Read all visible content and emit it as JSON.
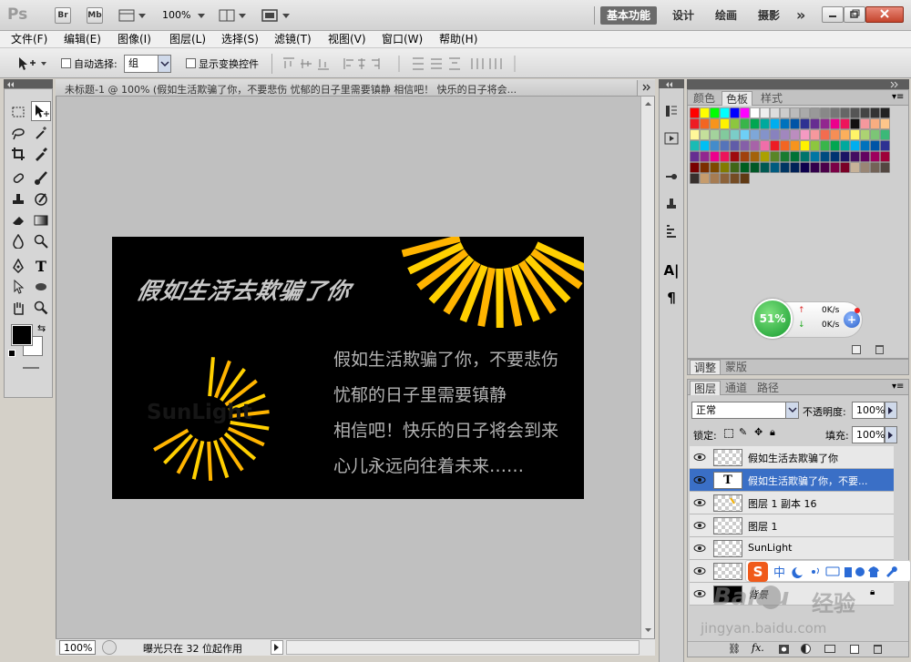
{
  "titlebar": {
    "ps_logo": "Ps",
    "br": "Br",
    "mb": "Mb",
    "zoom": "100%",
    "workspaces": [
      "基本功能",
      "设计",
      "绘画",
      "摄影"
    ],
    "more": "»"
  },
  "menu": [
    "文件(F)",
    "编辑(E)",
    "图像(I)",
    "图层(L)",
    "选择(S)",
    "滤镜(T)",
    "视图(V)",
    "窗口(W)",
    "帮助(H)"
  ],
  "options": {
    "auto_select_label": "自动选择:",
    "auto_select_value": "组",
    "show_transform_label": "显示变换控件"
  },
  "document": {
    "tab_title": "未标题-1 @ 100% (假如生活欺骗了你，不要悲伤 忧郁的日子里需要镇静 相信吧！ 快乐的日子将会...",
    "heading": "假如生活去欺骗了你",
    "logo_text": "SunLight",
    "poem": [
      "假如生活欺骗了你，不要悲伤",
      "忧郁的日子里需要镇静",
      "相信吧！快乐的日子将会到来",
      "心儿永远向往着未来……"
    ]
  },
  "status": {
    "zoom": "100%",
    "message": "曝光只在 32 位起作用"
  },
  "swatches_panel": {
    "tabs": [
      "颜色",
      "色板",
      "样式"
    ],
    "active": "色板"
  },
  "net_widget": {
    "percent": "51%",
    "up": "0K/s",
    "down": "0K/s"
  },
  "adjust_tabs": [
    "调整",
    "蒙版"
  ],
  "layers_panel": {
    "tabs": [
      "图层",
      "通道",
      "路径"
    ],
    "blend_mode": "正常",
    "opacity_label": "不透明度:",
    "opacity_value": "100%",
    "lock_label": "锁定:",
    "fill_label": "填充:",
    "fill_value": "100%",
    "layers": [
      {
        "name": "假如生活去欺骗了你",
        "type": "normal"
      },
      {
        "name": "假如生活欺骗了你，不要...",
        "type": "text",
        "selected": true
      },
      {
        "name": "图层 1 副本 16",
        "type": "normal"
      },
      {
        "name": "图层 1",
        "type": "normal"
      },
      {
        "name": "SunLight",
        "type": "normal"
      },
      {
        "name": "",
        "type": "normal"
      },
      {
        "name": "背景",
        "type": "background"
      }
    ],
    "text_thumb": "T"
  },
  "watermark": {
    "brand": "Baidu",
    "cn": "经验",
    "url": "jingyan.baidu.com"
  }
}
